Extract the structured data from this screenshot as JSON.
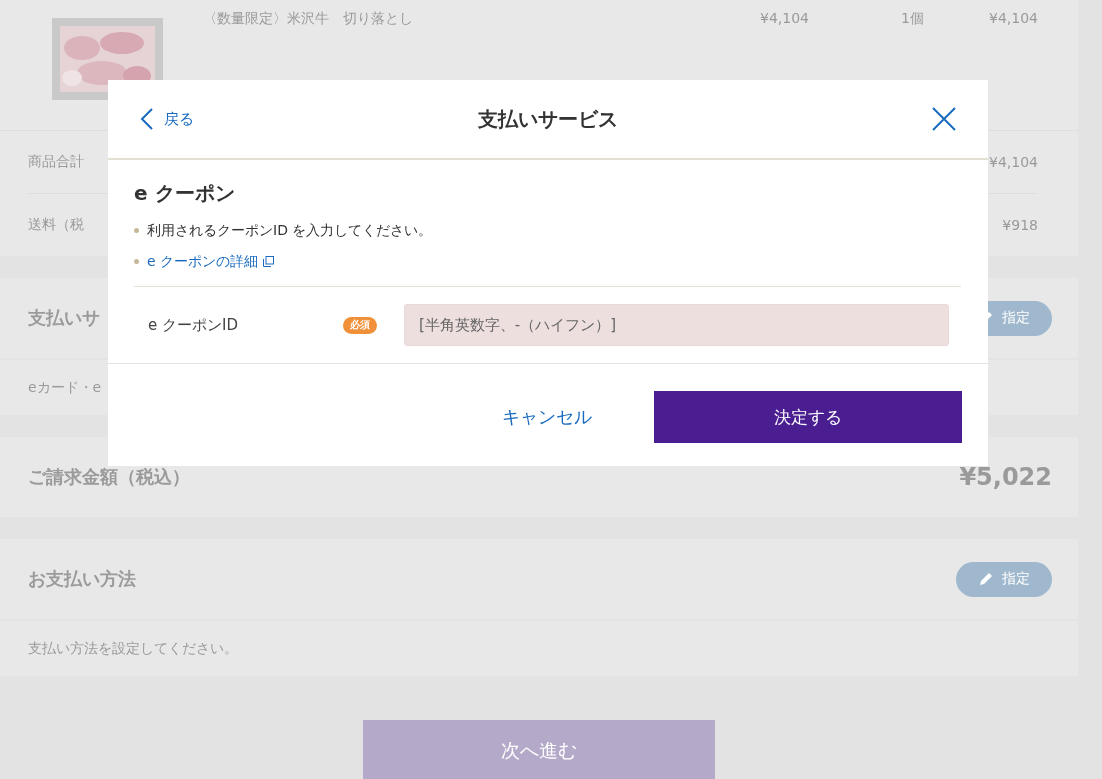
{
  "product": {
    "name": "〈数量限定〉米沢牛　切り落とし",
    "price": "¥4,104",
    "quantity": "1個",
    "subtotal": "¥4,104"
  },
  "totals": [
    {
      "label": "商品合計",
      "value": "¥4,104"
    },
    {
      "label": "送料（税",
      "value": "¥918"
    }
  ],
  "payment_service": {
    "title": "支払いサ",
    "button": "指定",
    "note": "eカード・e"
  },
  "billing": {
    "label": "ご請求金額（税込）",
    "amount": "¥5,022"
  },
  "payment_method": {
    "title": "お支払い方法",
    "button": "指定",
    "note": "支払い方法を設定してください。"
  },
  "next_button": "次へ進む",
  "modal": {
    "back": "戻る",
    "title": "支払いサービス",
    "heading": "e クーポン",
    "bullets": [
      {
        "kind": "text",
        "text": "利用されるクーポンID を入力してください。"
      },
      {
        "kind": "link",
        "text": "e クーポンの詳細"
      }
    ],
    "field": {
      "label": "e クーポンID",
      "badge": "必須",
      "placeholder": "[半角英数字、-（ハイフン）]"
    },
    "cancel": "キャンセル",
    "submit": "決定する"
  }
}
